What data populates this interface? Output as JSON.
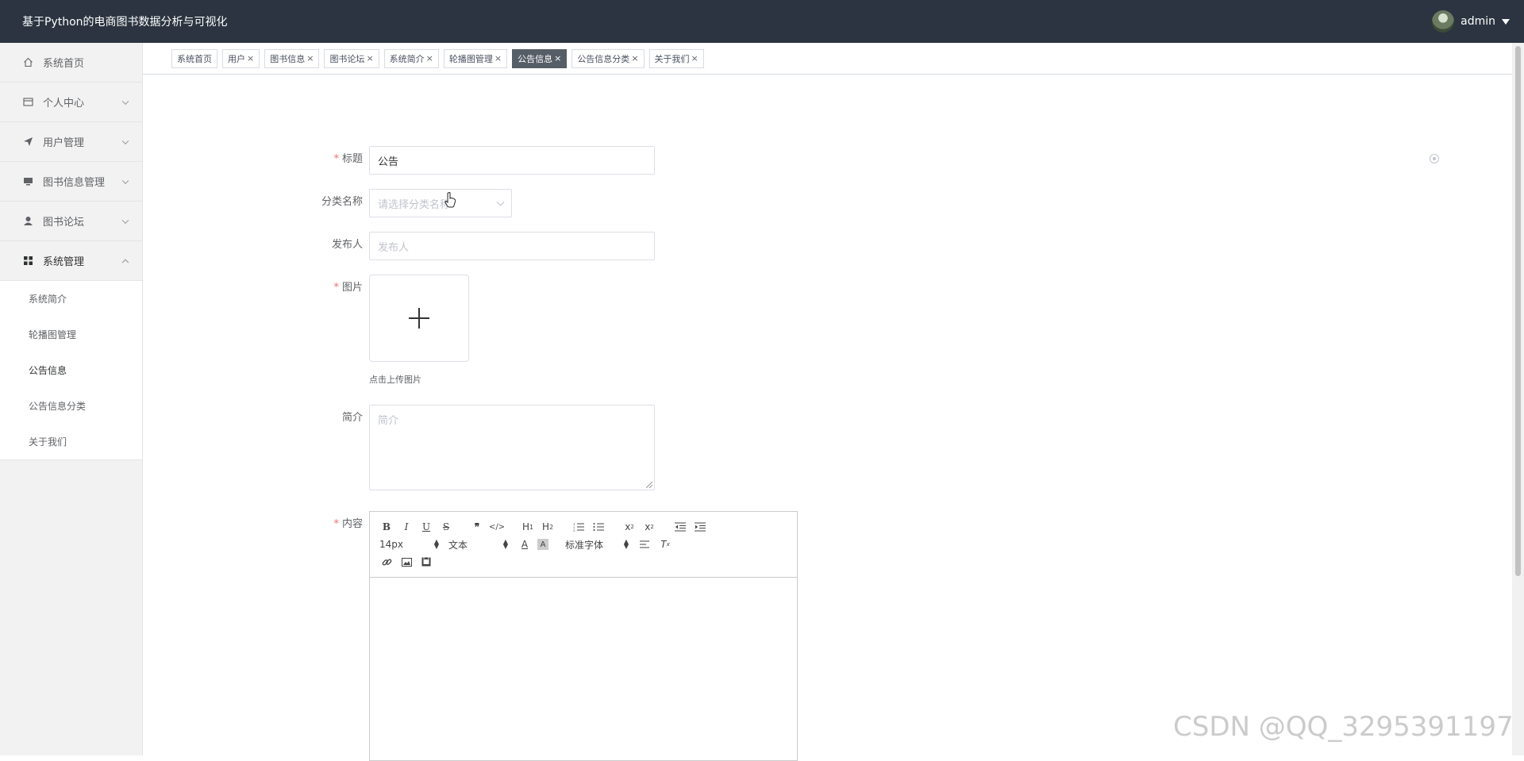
{
  "header": {
    "title": "基于Python的电商图书数据分析与可视化",
    "user": "admin"
  },
  "sidebar": {
    "items": [
      {
        "label": "系统首页",
        "icon": "home-icon",
        "expandable": false
      },
      {
        "label": "个人中心",
        "icon": "card-icon",
        "expandable": true
      },
      {
        "label": "用户管理",
        "icon": "send-icon",
        "expandable": true
      },
      {
        "label": "图书信息管理",
        "icon": "monitor-icon",
        "expandable": true
      },
      {
        "label": "图书论坛",
        "icon": "user-icon",
        "expandable": true
      },
      {
        "label": "系统管理",
        "icon": "grid-icon",
        "expandable": true,
        "expanded": true
      }
    ],
    "submenu": [
      "系统简介",
      "轮播图管理",
      "公告信息",
      "公告信息分类",
      "关于我们"
    ],
    "current_sub": "公告信息"
  },
  "tags": [
    {
      "label": "系统首页",
      "closable": false,
      "active": false
    },
    {
      "label": "用户",
      "closable": true,
      "active": false
    },
    {
      "label": "图书信息",
      "closable": true,
      "active": false
    },
    {
      "label": "图书论坛",
      "closable": true,
      "active": false
    },
    {
      "label": "系统简介",
      "closable": true,
      "active": false
    },
    {
      "label": "轮播图管理",
      "closable": true,
      "active": false
    },
    {
      "label": "公告信息",
      "closable": true,
      "active": true
    },
    {
      "label": "公告信息分类",
      "closable": true,
      "active": false
    },
    {
      "label": "关于我们",
      "closable": true,
      "active": false
    }
  ],
  "form": {
    "title_label": "标题",
    "title_value": "公告",
    "category_label": "分类名称",
    "category_placeholder": "请选择分类名称",
    "publisher_label": "发布人",
    "publisher_placeholder": "发布人",
    "image_label": "图片",
    "upload_tip": "点击上传图片",
    "intro_label": "简介",
    "intro_placeholder": "简介",
    "content_label": "内容"
  },
  "editor": {
    "font_size": "14px",
    "text_style": "文本",
    "font_family": "标准字体"
  },
  "watermark": "CSDN @QQ_3295391197",
  "colors": {
    "header": "#2b3440",
    "required": "#f56c6c",
    "active_tag": "#555d66"
  }
}
